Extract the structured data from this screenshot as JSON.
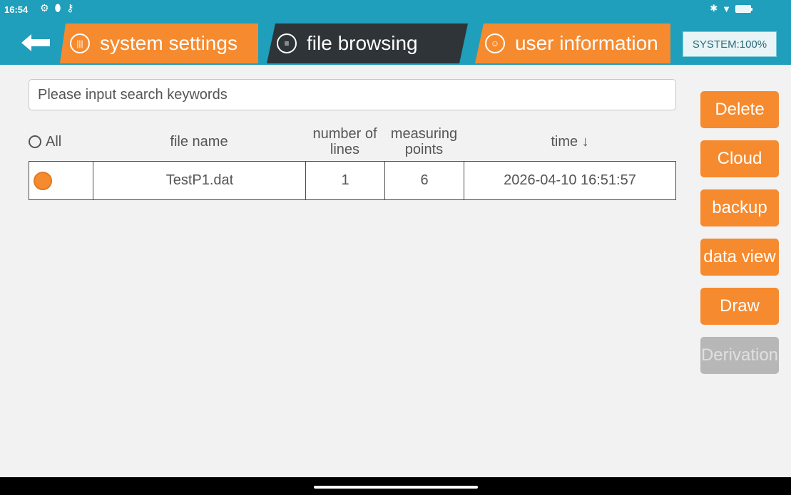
{
  "status": {
    "time": "16:54",
    "left_icons": [
      "gear-icon",
      "location-icon",
      "key-icon"
    ],
    "right_icons": [
      "bluetooth-icon",
      "wifi-icon",
      "battery-icon"
    ],
    "battery_label": "100"
  },
  "header": {
    "back_icon": "arrow-left-icon",
    "tabs": [
      {
        "label": "system settings",
        "icon": "sliders-icon",
        "active": false
      },
      {
        "label": "file browsing",
        "icon": "search-list-icon",
        "active": true
      },
      {
        "label": "user information",
        "icon": "user-icon",
        "active": false
      }
    ],
    "system_status": "SYSTEM:100%"
  },
  "search": {
    "placeholder": "Please input search keywords",
    "value": ""
  },
  "table": {
    "select_all_label": "All",
    "headers": {
      "file_name": "file name",
      "number_of_lines": "number of\nlines",
      "measuring_points": "measuring\npoints",
      "time": "time ↓"
    },
    "rows": [
      {
        "selected": true,
        "file_name": "TestP1.dat",
        "number_of_lines": "1",
        "measuring_points": "6",
        "time": "2026-04-10 16:51:57"
      }
    ]
  },
  "actions": {
    "delete": "Delete",
    "cloud": "Cloud",
    "backup": "backup",
    "data_view": "data view",
    "draw": "Draw",
    "derivation": "Derivation"
  },
  "colors": {
    "topbar": "#1f9fbb",
    "accent": "#f68a2e",
    "active_tab": "#2e3438",
    "disabled": "#b7b7b7"
  }
}
